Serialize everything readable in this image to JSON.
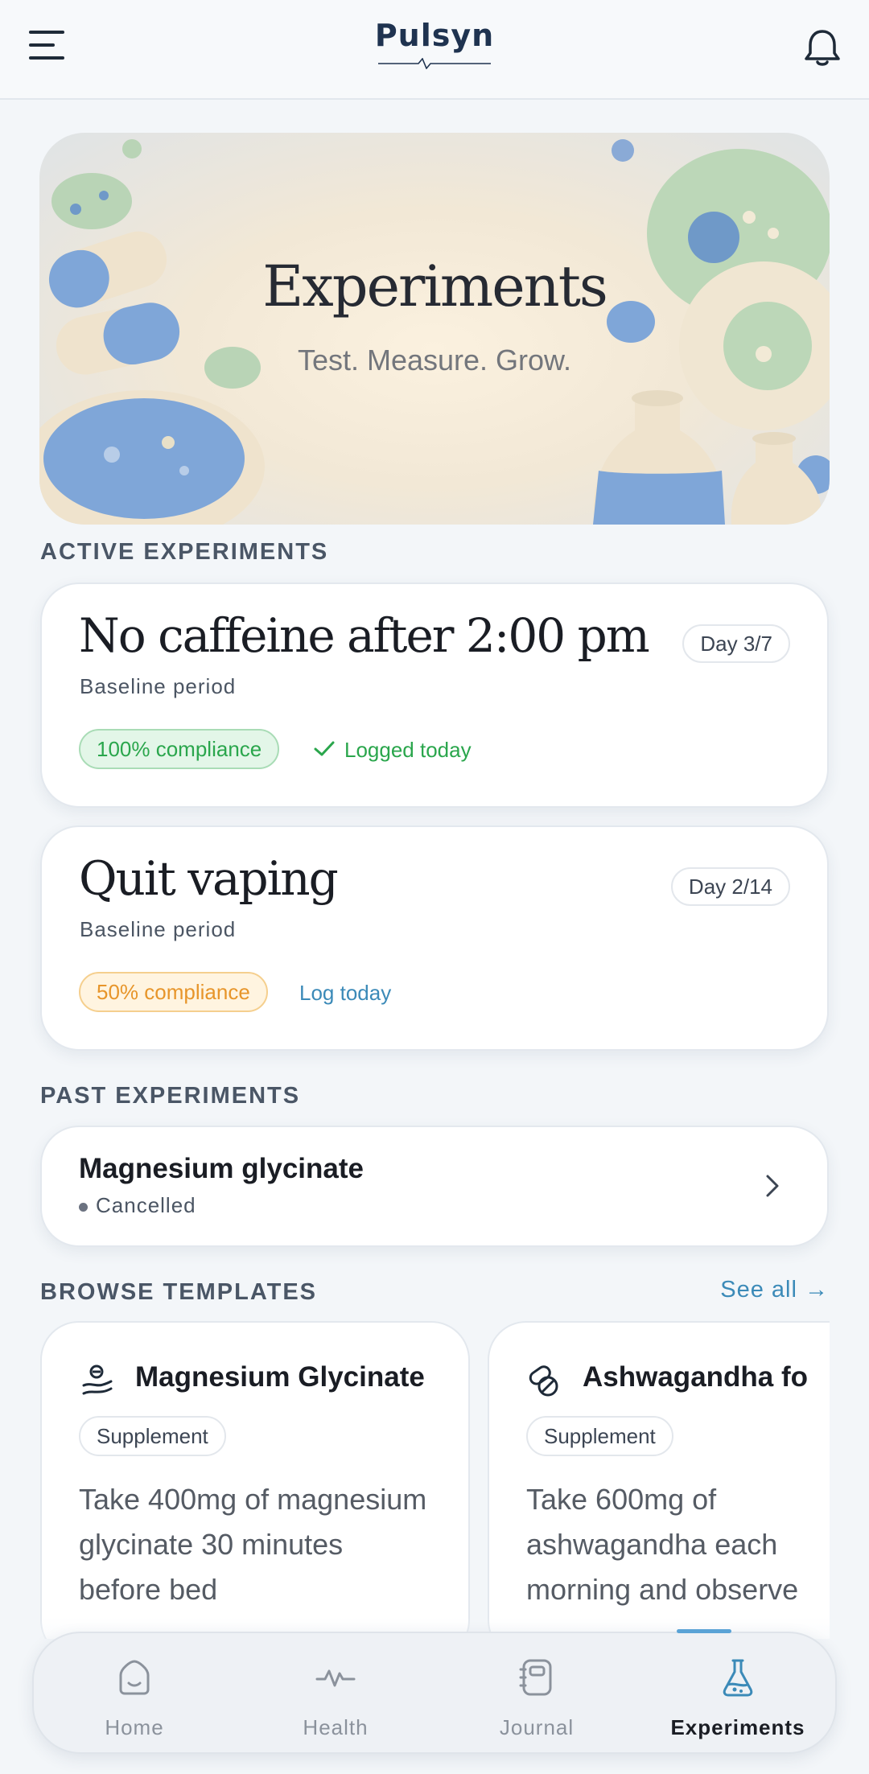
{
  "header": {
    "logo_text": "Pulsyn",
    "menu_icon": "hamburger-menu-icon",
    "notification_icon": "bell-icon"
  },
  "hero": {
    "title": "Experiments",
    "subtitle": "Test. Measure. Grow."
  },
  "active_section": {
    "title": "ACTIVE EXPERIMENTS",
    "items": [
      {
        "title": "No caffeine after 2:00 pm",
        "subtitle": "Baseline period",
        "day": "Day 3/7",
        "compliance": "100% compliance",
        "status": "Logged today",
        "status_icon": "checkmark-icon"
      },
      {
        "title": "Quit vaping",
        "subtitle": "Baseline period",
        "day": "Day 2/14",
        "compliance": "50% compliance",
        "status": "Log today"
      }
    ]
  },
  "past_section": {
    "title": "PAST EXPERIMENTS",
    "items": [
      {
        "title": "Magnesium glycinate",
        "status": "Cancelled"
      }
    ]
  },
  "templates_section": {
    "title": "BROWSE TEMPLATES",
    "see_all": "See all →",
    "items": [
      {
        "icon": "supplement-hand-icon",
        "title": "Magnesium Glycinate",
        "tag": "Supplement",
        "description": "Take 400mg of magnesium glycinate 30 minutes before bed"
      },
      {
        "icon": "pills-icon",
        "title": "Ashwagandha fo",
        "tag": "Supplement",
        "description": "Take 600mg of ashwagandha each morning and observe"
      }
    ]
  },
  "bottom_nav": {
    "items": [
      {
        "label": "Home",
        "icon": "home-icon",
        "active": false
      },
      {
        "label": "Health",
        "icon": "pulse-icon",
        "active": false
      },
      {
        "label": "Journal",
        "icon": "journal-icon",
        "active": false
      },
      {
        "label": "Experiments",
        "icon": "flask-icon",
        "active": true
      }
    ]
  },
  "colors": {
    "accent": "#3b8ab8",
    "success": "#2aa64c",
    "warning": "#e7952a",
    "background": "#f3f6f9"
  }
}
